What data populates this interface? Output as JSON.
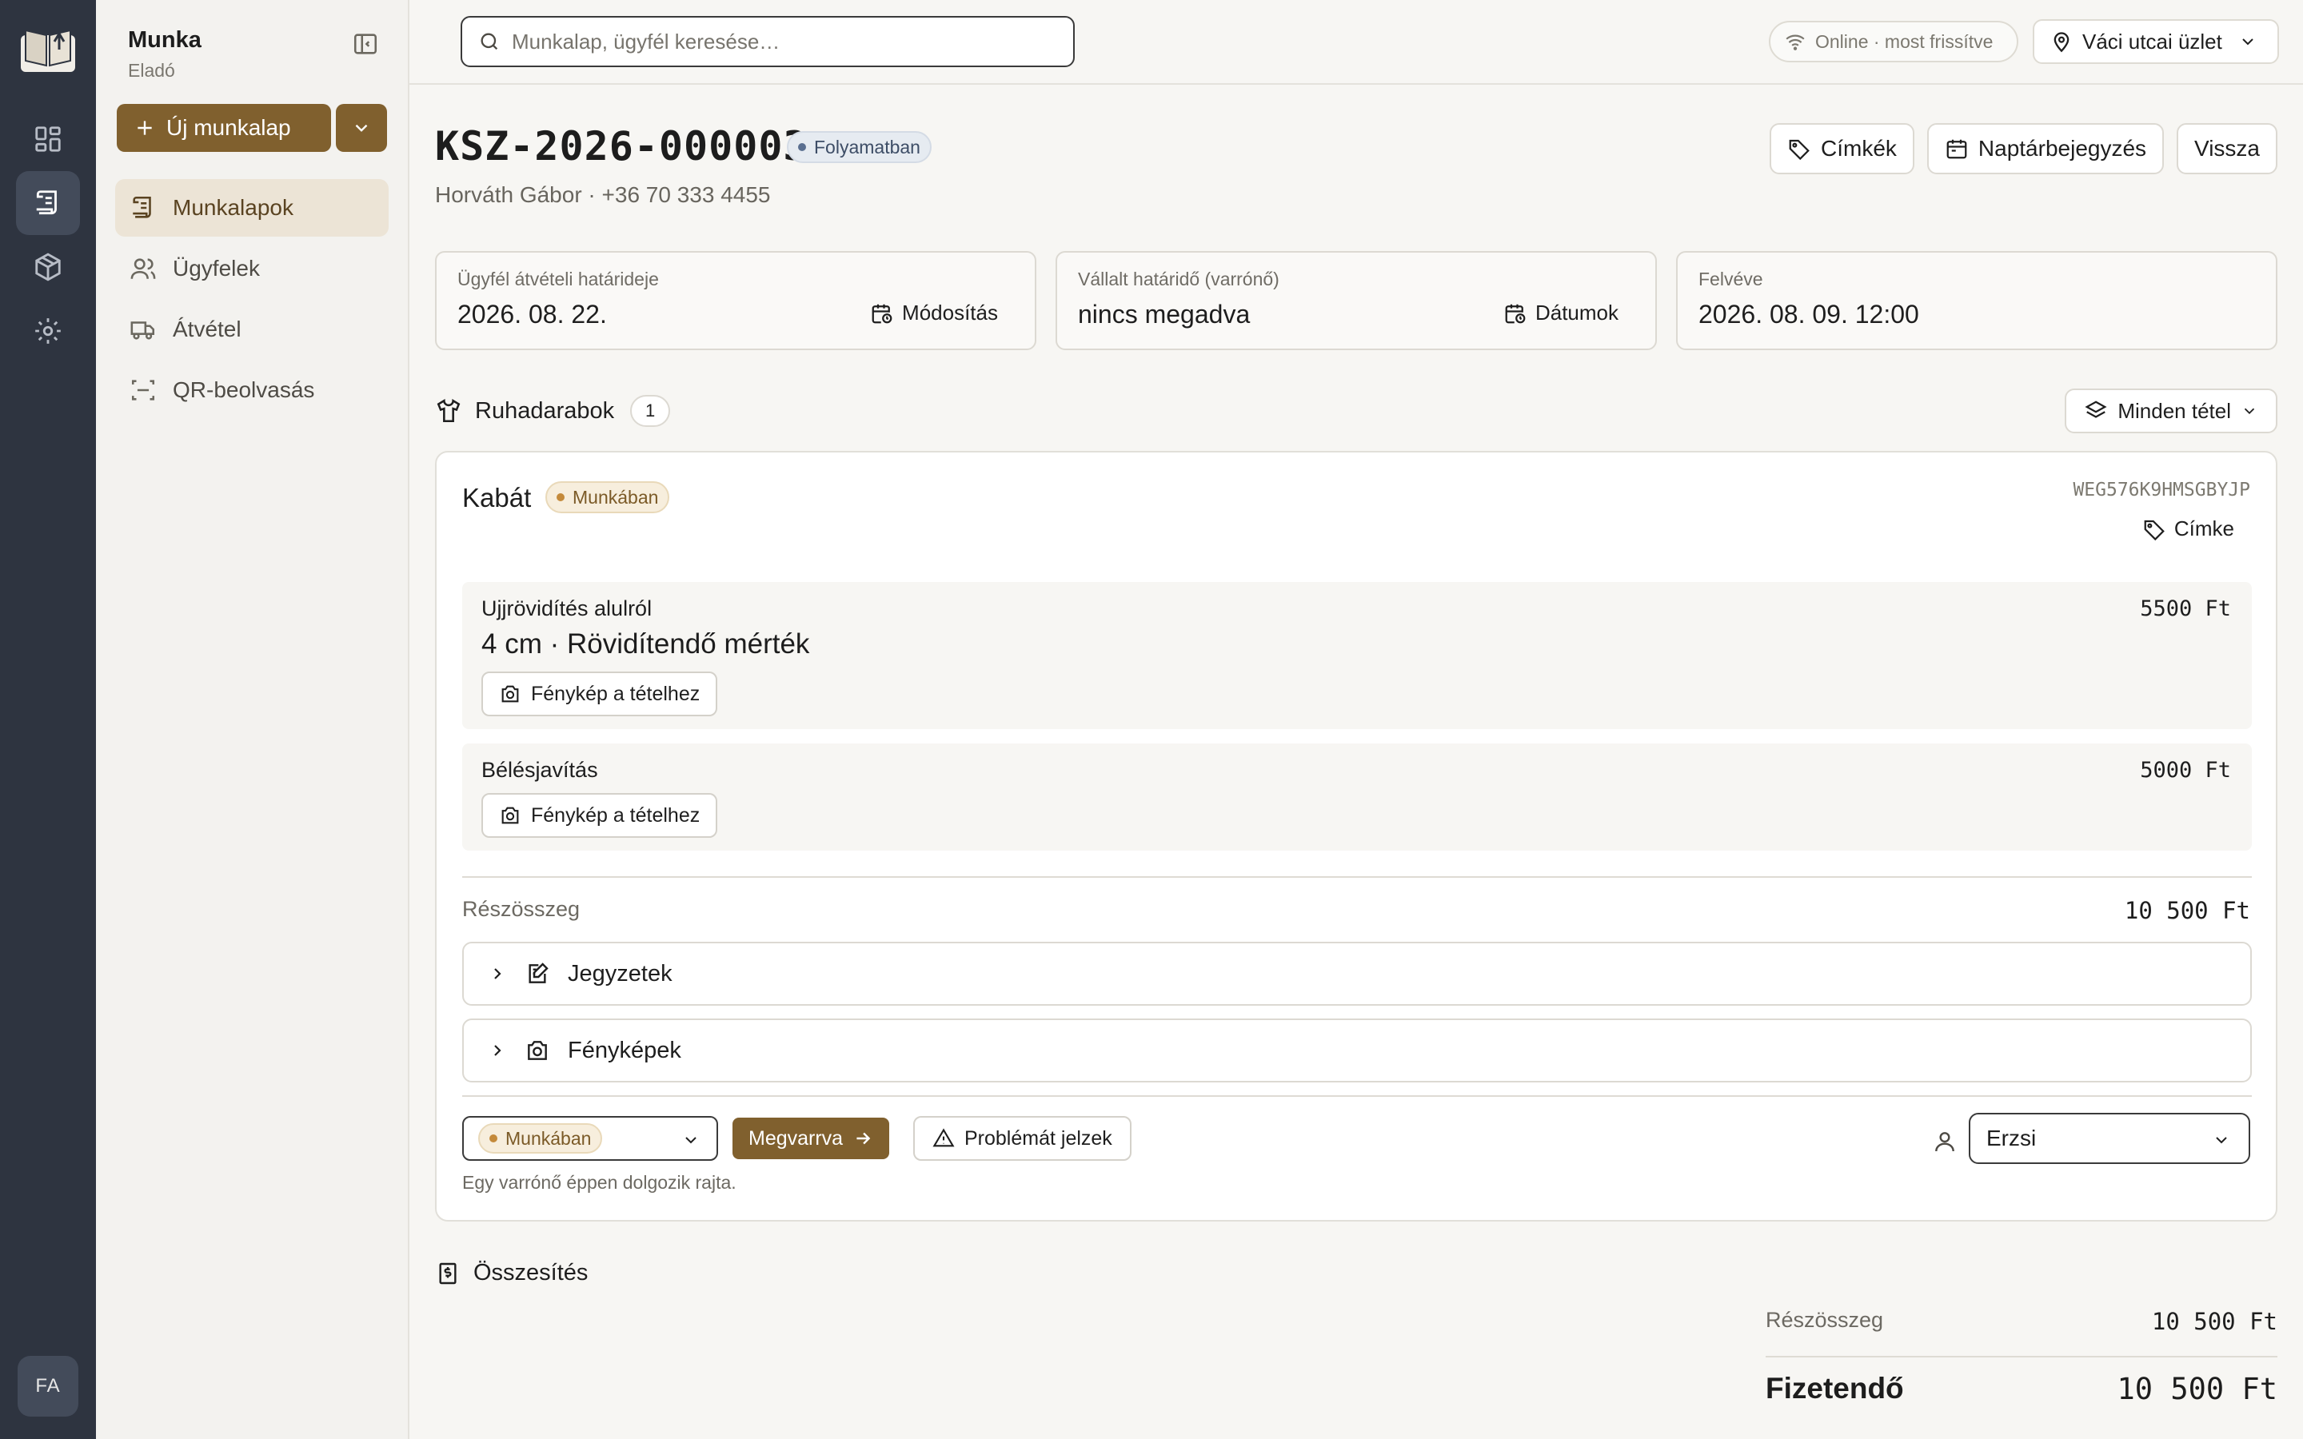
{
  "colors": {
    "rail": "#2e3440",
    "accent": "#80602e",
    "status_blue": "#5a6f90",
    "status_amber": "#c48a3b"
  },
  "rail": {
    "logo_icon": "book-logo-icon",
    "items": [
      {
        "icon": "dashboard-icon"
      },
      {
        "icon": "worksheet-icon",
        "active": true
      },
      {
        "icon": "box-icon"
      },
      {
        "icon": "gear-icon"
      }
    ],
    "avatar": "FA"
  },
  "sidebar": {
    "title": "Munka",
    "subtitle": "Eladó",
    "new_button": "Új munkalap",
    "items": [
      {
        "label": "Munkalapok",
        "icon": "worksheet-icon",
        "active": true
      },
      {
        "label": "Ügyfelek",
        "icon": "users-icon"
      },
      {
        "label": "Átvétel",
        "icon": "truck-icon"
      },
      {
        "label": "QR-beolvasás",
        "icon": "scan-icon"
      }
    ]
  },
  "topbar": {
    "search_placeholder": "Munkalap, ügyfél keresése…",
    "online_status": "Online · most frissítve",
    "store": "Váci utcai üzlet"
  },
  "order": {
    "id": "KSZ-2026-000003",
    "status": "Folyamatban",
    "customer": "Horváth Gábor · +36 70 333 4455",
    "actions": {
      "tags": "Címkék",
      "calendar": "Naptárbejegyzés",
      "back": "Vissza"
    },
    "dates": [
      {
        "label": "Ügyfél átvételi határideje",
        "value": "2026. 08. 22.",
        "action": "Módosítás"
      },
      {
        "label": "Vállalt határidő (varrónő)",
        "value": "nincs megadva",
        "action": "Dátumok"
      },
      {
        "label": "Felvéve",
        "value": "2026. 08. 09. 12:00"
      }
    ]
  },
  "garments": {
    "title": "Ruhadarabok",
    "count": "1",
    "filter": "Minden tétel",
    "item": {
      "name": "Kabát",
      "status": "Munkában",
      "code": "WEG576K9HMSGBYJP",
      "label_button": "Címke",
      "services": [
        {
          "name": "Ujjrövidítés alulról",
          "description": "4 cm · Rövidítendő mérték",
          "price": "5500 Ft",
          "photo_button": "Fénykép a tételhez"
        },
        {
          "name": "Bélésjavítás",
          "price": "5000 Ft",
          "photo_button": "Fénykép a tételhez"
        }
      ],
      "subtotal_label": "Részösszeg",
      "subtotal": "10 500 Ft",
      "notes": "Jegyzetek",
      "photos": "Fényképek",
      "status_select": "Munkában",
      "done_button": "Megvarrva",
      "problem_button": "Problémát jelzek",
      "status_hint": "Egy varrónő éppen dolgozik rajta.",
      "assignee": "Erzsi"
    }
  },
  "summary": {
    "title": "Összesítés",
    "subtotal_label": "Részösszeg",
    "subtotal": "10 500 Ft",
    "total_label": "Fizetendő",
    "total": "10 500 Ft"
  }
}
